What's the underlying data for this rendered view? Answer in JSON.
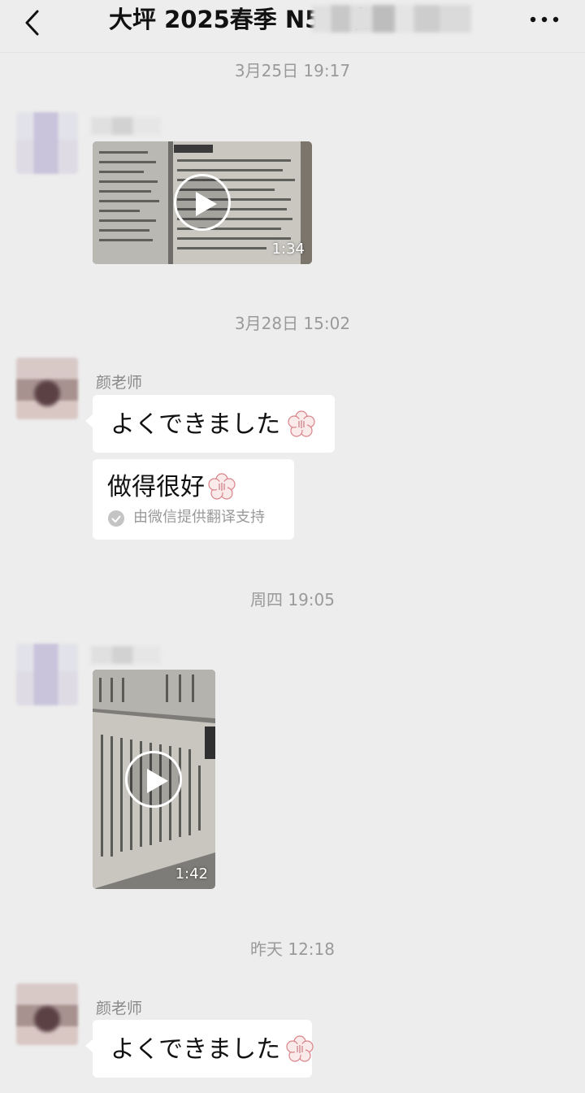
{
  "header": {
    "title": "大坪 2025春季 N5-1班",
    "back_icon": "chevron-left-icon",
    "more_icon": "more-dots-icon"
  },
  "messages": [
    {
      "timestamp": "3月25日 19:17",
      "type": "video",
      "duration": "1:34"
    },
    {
      "timestamp": "3月28日 15:02",
      "sender": "颜老师",
      "type": "text",
      "text": "よくできました",
      "emoji": "sakura-stamp-icon",
      "translation": {
        "text": "做得很好",
        "source_label": "由微信提供翻译支持"
      }
    },
    {
      "timestamp": "周四 19:05",
      "type": "video",
      "duration": "1:42"
    },
    {
      "timestamp": "昨天 12:18",
      "sender": "颜老师",
      "type": "text",
      "text": "よくできました",
      "emoji": "sakura-stamp-icon"
    }
  ],
  "colors": {
    "background": "#ededed",
    "bubble": "#ffffff",
    "timestamp": "#9a9a9a",
    "sender": "#8a8a8a"
  }
}
